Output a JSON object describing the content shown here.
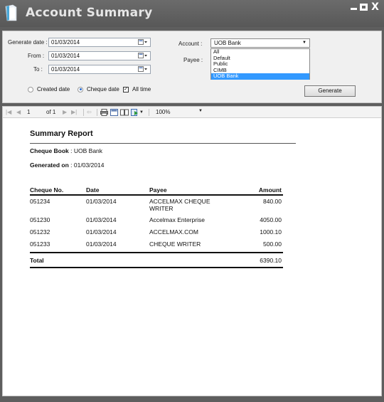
{
  "window": {
    "title": "Account Summary",
    "controls": {
      "minimize": "minimize-icon",
      "maximize": "maximize-icon",
      "close": "X"
    }
  },
  "filters": {
    "generate_date_label": "Generate date :",
    "generate_date": "01/03/2014",
    "from_label": "From :",
    "from_date": "01/03/2014",
    "to_label": "To :",
    "to_date": "01/03/2014",
    "account_label": "Account :",
    "account_selected": "UOB Bank",
    "account_options": [
      "All",
      "Default",
      "Public",
      "CIMB",
      "UOB Bank"
    ],
    "payee_label": "Payee :",
    "radio_created": "Created date",
    "radio_cheque": "Cheque date",
    "selected_date_type": "Cheque date",
    "all_time_label": "All time",
    "all_time_checked": true,
    "generate_button": "Generate"
  },
  "toolbar": {
    "page_current": "1",
    "page_of": "of 1",
    "zoom": "100%"
  },
  "report": {
    "title": "Summary Report",
    "cheque_book_label": "Cheque Book",
    "cheque_book_value": ": UOB Bank",
    "generated_on_label": "Generated on",
    "generated_on_value": ": 01/03/2014",
    "columns": [
      "Cheque No.",
      "Date",
      "Payee",
      "Amount"
    ],
    "rows": [
      {
        "cheque_no": "051234",
        "date": "01/03/2014",
        "payee": "ACCELMAX CHEQUE WRITER",
        "amount": "840.00"
      },
      {
        "cheque_no": "051230",
        "date": "01/03/2014",
        "payee": "Accelmax Enterprise",
        "amount": "4050.00"
      },
      {
        "cheque_no": "051232",
        "date": "01/03/2014",
        "payee": "ACCELMAX.COM",
        "amount": "1000.10"
      },
      {
        "cheque_no": "051233",
        "date": "01/03/2014",
        "payee": "CHEQUE WRITER",
        "amount": "500.00"
      }
    ],
    "total_label": "Total",
    "total_amount": "6390.10"
  }
}
